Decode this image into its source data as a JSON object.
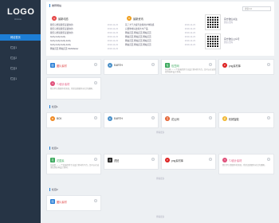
{
  "sidebar": {
    "logo": "LOGO",
    "logo_sub": "Website",
    "items": [
      {
        "label": "网站首页"
      },
      {
        "label": "栏目1"
      },
      {
        "label": "栏目2"
      },
      {
        "label": "栏目3"
      },
      {
        "label": "栏目1"
      }
    ]
  },
  "top": {
    "section_title": "推荐网站",
    "search_placeholder": "搜索Ctrl"
  },
  "news_left": {
    "title": "最新动态",
    "rows": [
      {
        "t": "我们只想说我们是最快的",
        "d": "2019-12-23"
      },
      {
        "t": "我们只想说我们是最快的",
        "d": "2019-12-23"
      },
      {
        "t": "我们只想说我们是最快的",
        "d": "2019-12-23"
      },
      {
        "t": "foxfly.foxfly.foxfly",
        "d": "2019-12-23"
      },
      {
        "t": "foxfly.foxfly.foxfly.foxfly",
        "d": "2019-12-23"
      },
      {
        "t": "foxfly.foxfly.foxfly.foxfly",
        "d": "2019-12-23"
      },
      {
        "t": "网站首页.网站首页.WebMaster",
        "d": "2019-12-23"
      }
    ]
  },
  "news_right": {
    "title": "最新资讯",
    "rows": [
      {
        "t": "花了大气力提升这些用户体验感",
        "d": "2019-12-23"
      },
      {
        "t": "只要你用好这些大众产品",
        "d": "2019-12-23"
      },
      {
        "t": "网站首页,网站首页,网站首页",
        "d": "2019-12-23"
      },
      {
        "t": "网站首页,网站首页,网站首页",
        "d": "2019-12-23"
      },
      {
        "t": "网站首页,网站首页,网站首页",
        "d": "2019-12-23"
      },
      {
        "t": "网站首页,网站首页,网站首页",
        "d": "2019-12-23"
      }
    ]
  },
  "qr": [
    {
      "label": "官方微信关注",
      "sub": "微信扫码"
    },
    {
      "label": "官方微信公众号",
      "sub": "微信扫码"
    }
  ],
  "recommend": [
    {
      "name": "图片素材",
      "color": "#2b7fd6",
      "icon": "图",
      "desc": ""
    },
    {
      "name": "EARTH",
      "color": "#4a90c8",
      "icon": "E",
      "desc": ""
    },
    {
      "name": "包豆网",
      "color": "#3aa85c",
      "icon": "包",
      "desc": "包豆网 — 一个快速提供专业设计素材的平台，您可以在这里找到各种设计素材。"
    },
    {
      "name": "png素材库",
      "color": "#d22",
      "icon": "P",
      "desc": ""
    },
    {
      "name": "TJ设计素材",
      "color": "#e0507a",
      "icon": "T",
      "desc": "我们不只想要你的美感，我们还想要你对它的理解。"
    }
  ],
  "sections": [
    {
      "title": "栏目1",
      "items": [
        {
          "name": "BCK",
          "color": "#f08a24",
          "icon": "B"
        },
        {
          "name": "EARTH",
          "color": "#4a90c8",
          "icon": "E"
        },
        {
          "name": "花山网",
          "color": "#e35d2b",
          "icon": "花"
        },
        {
          "name": "机械智能",
          "color": "#f0b429",
          "icon": "机"
        }
      ],
      "more": "查看更多"
    },
    {
      "title": "栏目4",
      "items": [
        {
          "name": "花园素",
          "color": "#3aa85c",
          "icon": "花",
          "desc": "花园素 — 一个快速提供专业设计素材的平台，您可以在这里找到各种设计素材。"
        },
        {
          "name": "虎拍",
          "color": "#222",
          "icon": "虎"
        },
        {
          "name": "png素材库",
          "color": "#d22",
          "icon": "P"
        },
        {
          "name": "TJ设计素材",
          "color": "#e0507a",
          "icon": "T",
          "desc": "我们不只想要你的美感，我们还想要你对它的理解。"
        }
      ],
      "more": "查看更多"
    },
    {
      "title": "栏目2",
      "items": [
        {
          "name": "图片素材",
          "color": "#2b7fd6",
          "icon": "图"
        }
      ],
      "more": "查看更多"
    }
  ]
}
